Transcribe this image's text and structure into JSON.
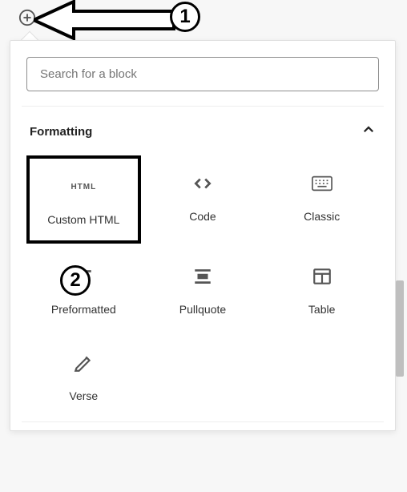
{
  "annotations": {
    "label1": "1",
    "label2": "2"
  },
  "search": {
    "placeholder": "Search for a block"
  },
  "section": {
    "title": "Formatting",
    "expanded": true
  },
  "blocks": [
    {
      "icon": "html-icon",
      "label": "Custom HTML"
    },
    {
      "icon": "code-icon",
      "label": "Code"
    },
    {
      "icon": "classic-icon",
      "label": "Classic"
    },
    {
      "icon": "preformatted-icon",
      "label": "Preformatted"
    },
    {
      "icon": "pullquote-icon",
      "label": "Pullquote"
    },
    {
      "icon": "table-icon",
      "label": "Table"
    },
    {
      "icon": "verse-icon",
      "label": "Verse"
    }
  ]
}
